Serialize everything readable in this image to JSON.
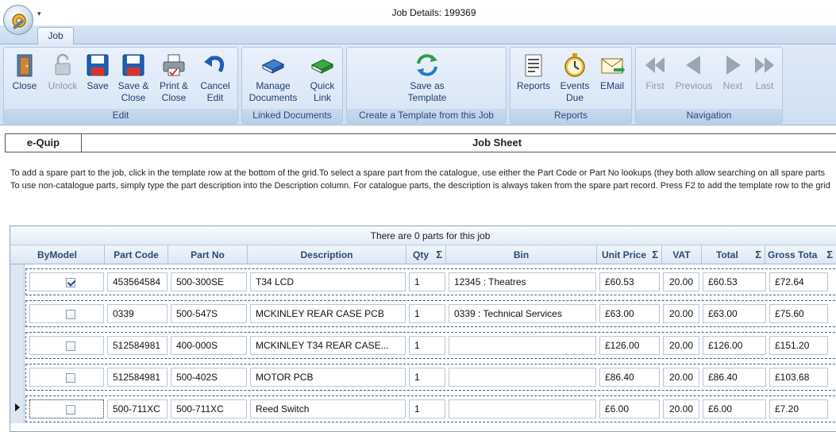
{
  "window": {
    "title": "Job Details: 199369",
    "qat_arrow": "▾"
  },
  "tabs": [
    {
      "label": "Job"
    }
  ],
  "ribbon": {
    "edit": {
      "label": "Edit",
      "close": "Close",
      "unlock": "Unlock",
      "save": "Save",
      "save_close": [
        "Save &",
        "Close"
      ],
      "print_close": [
        "Print &",
        "Close"
      ],
      "cancel_edit": [
        "Cancel",
        "Edit"
      ]
    },
    "linked": {
      "label": "Linked Documents",
      "manage": [
        "Manage",
        "Documents"
      ],
      "quick": [
        "Quick",
        "Link"
      ]
    },
    "template": {
      "label": "Create a Template from this Job",
      "save_as": [
        "Save as",
        "Template"
      ]
    },
    "reports": {
      "label": "Reports",
      "reports": "Reports",
      "events": [
        "Events",
        "Due"
      ],
      "email": "EMail"
    },
    "navigation": {
      "label": "Navigation",
      "first": "First",
      "previous": "Previous",
      "next": "Next",
      "last": "Last"
    }
  },
  "header": {
    "left": "e-Quip",
    "center": "Job Sheet"
  },
  "help": {
    "line1": "To add a spare part to the job, click in the template row at the bottom of the grid.To select a spare part from the catalogue, use either the Part Code or Part No lookups (they both allow searching on all spare parts",
    "line2": "To use non-catalogue parts, simply type the part description into the Description column. For catalogue parts, the description is always taken from the spare part record. Press F2 to add the template row to the grid"
  },
  "grid": {
    "caption": "There are 0 parts for this job",
    "columns": [
      "ByModel",
      "Part Code",
      "Part No",
      "Description",
      "Qty",
      "Bin",
      "Unit Price",
      "VAT",
      "Total",
      "Gross Tota"
    ],
    "sigma": "Σ",
    "rows": [
      {
        "by_model": true,
        "part_code": "453564584",
        "part_no": "500-300SE",
        "description": "T34 LCD",
        "qty": "1",
        "bin": "12345 : Theatres",
        "unit_price": "£60.53",
        "vat": "20.00",
        "total": "£60.53",
        "gross": "£72.64"
      },
      {
        "by_model": false,
        "part_code": "0339",
        "part_no": "500-547S",
        "description": "MCKINLEY REAR CASE PCB",
        "qty": "1",
        "bin": "0339 : Technical Services",
        "unit_price": "£63.00",
        "vat": "20.00",
        "total": "£63.00",
        "gross": "£75.60"
      },
      {
        "by_model": false,
        "part_code": "512584981",
        "part_no": "400-000S",
        "description": "MCKINLEY  T34  REAR CASE...",
        "qty": "1",
        "bin": "",
        "unit_price": "£126.00",
        "vat": "20.00",
        "total": "£126.00",
        "gross": "£151.20"
      },
      {
        "by_model": false,
        "part_code": "512584981",
        "part_no": "500-402S",
        "description": "MOTOR PCB",
        "qty": "1",
        "bin": "",
        "unit_price": "£86.40",
        "vat": "20.00",
        "total": "£86.40",
        "gross": "£103.68"
      },
      {
        "by_model": false,
        "part_code": "500-711XC",
        "part_no": "500-711XC",
        "description": "Reed Switch",
        "qty": "1",
        "bin": "",
        "unit_price": "£6.00",
        "vat": "20.00",
        "total": "£6.00",
        "gross": "£7.20"
      }
    ]
  }
}
